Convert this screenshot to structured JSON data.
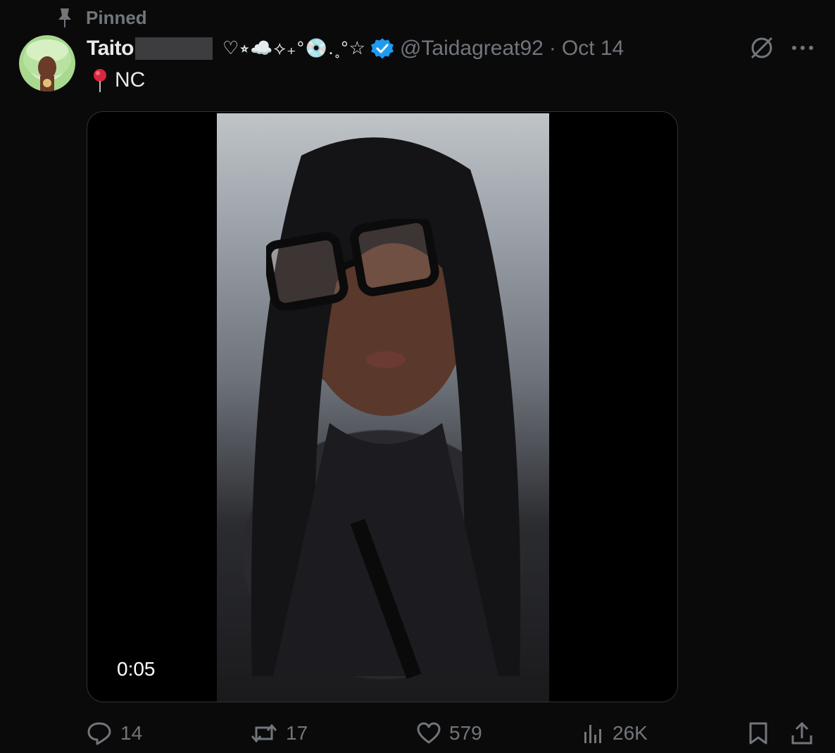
{
  "pinned": {
    "label": "Pinned",
    "icon": "pin-icon"
  },
  "author": {
    "display_name": "Taito",
    "decorations": "♡⭒☁️⟡₊°💿.˳°☆",
    "handle": "@Taidagreat92",
    "separator": "·",
    "date": "Oct 14",
    "verified": true,
    "verified_color": "#1d9bf0"
  },
  "post": {
    "location_emoji": "pin-emoji",
    "location_text": "NC"
  },
  "media": {
    "type": "video",
    "timestamp": "0:05"
  },
  "actions": {
    "reply_count": "14",
    "repost_count": "17",
    "like_count": "579",
    "views_count": "26K"
  },
  "colors": {
    "background": "#0a0a0b",
    "text_primary": "#e7e9ea",
    "text_secondary": "#71767b",
    "border": "#2f3336",
    "accent": "#1d9bf0"
  }
}
